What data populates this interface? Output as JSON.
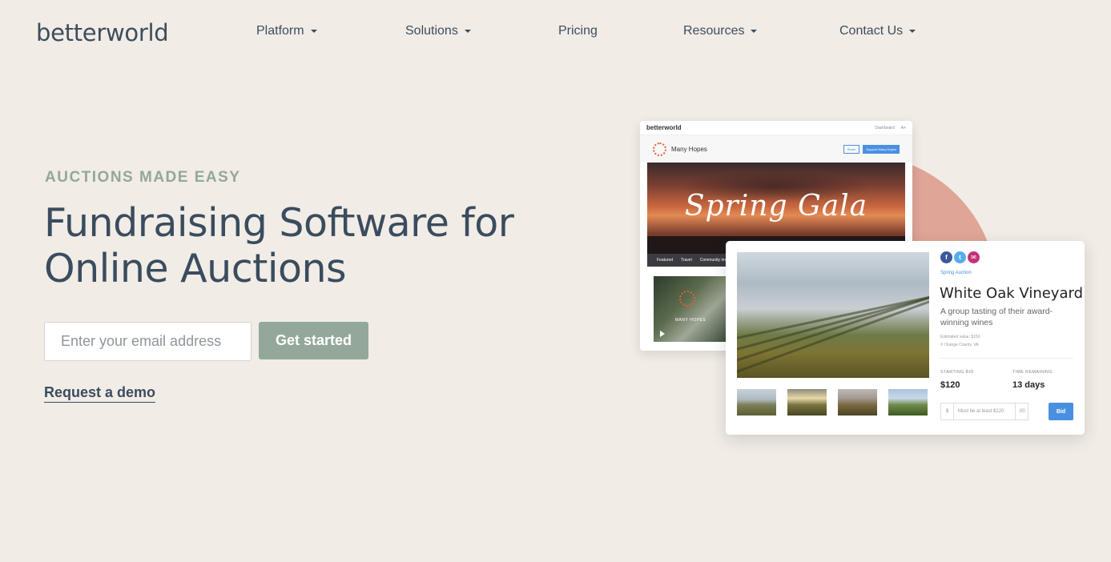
{
  "header": {
    "logo": "betterworld",
    "nav": [
      {
        "label": "Platform",
        "has_caret": true
      },
      {
        "label": "Solutions",
        "has_caret": true
      },
      {
        "label": "Pricing",
        "has_caret": false
      },
      {
        "label": "Resources",
        "has_caret": true
      },
      {
        "label": "Contact Us",
        "has_caret": true
      }
    ]
  },
  "hero": {
    "eyebrow": "AUCTIONS MADE EASY",
    "title_line1": "Fundraising Software for",
    "title_line2": "Online Auctions",
    "email_placeholder": "Enter your email address",
    "cta_label": "Get started",
    "demo_link": "Request a demo"
  },
  "illustration": {
    "browser": {
      "logo": "betterworld",
      "top_links": [
        "Dashboard",
        "A+"
      ],
      "org_name": "Many Hopes",
      "share_btn": "Share",
      "support_btn": "Support Many Hopes",
      "banner_title": "Spring Gala",
      "tabs": [
        "Featured",
        "Travel",
        "Community Impact"
      ],
      "video_text": "MANY HOPES"
    },
    "card": {
      "kicker": "Spring Auction",
      "title": "White Oak Vineyard",
      "description": "A group tasting of their award-winning wines",
      "estimated_value": "Estimated value: $150",
      "location": "Orange County, VA",
      "starting_bid_label": "STARTING BID",
      "starting_bid_value": "$120",
      "time_remaining_label": "TIME REMAINING",
      "time_remaining_value": "13 days",
      "bid_prefix": "$",
      "bid_placeholder": "Must be at least $120",
      "bid_suffix": ".00",
      "bid_button": "Bid"
    }
  },
  "colors": {
    "background": "#f1ece6",
    "heading": "#3a4c5e",
    "accent_green": "#93a89a",
    "blob": "#dfa597",
    "link_blue": "#4a90e2"
  }
}
